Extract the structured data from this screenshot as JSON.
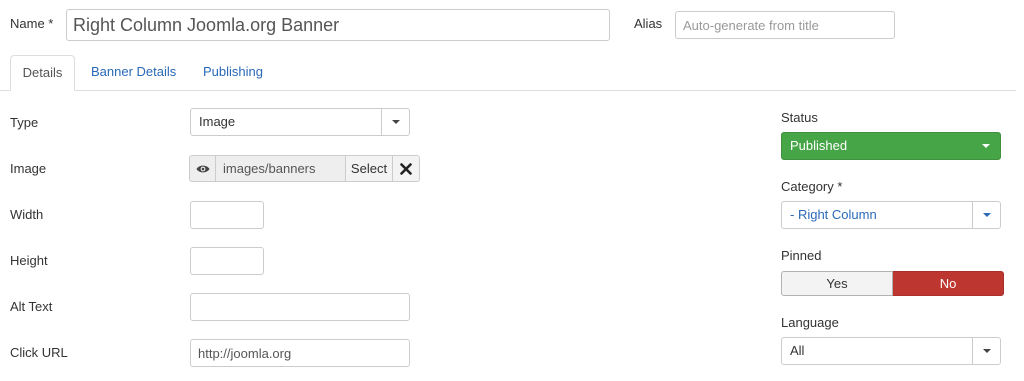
{
  "header": {
    "name_label": "Name *",
    "name_value": "Right Column Joomla.org Banner",
    "alias_label": "Alias",
    "alias_placeholder": "Auto-generate from title"
  },
  "tabs": [
    {
      "label": "Details",
      "active": true
    },
    {
      "label": "Banner Details",
      "active": false
    },
    {
      "label": "Publishing",
      "active": false
    }
  ],
  "form": {
    "type_label": "Type",
    "type_value": "Image",
    "image_label": "Image",
    "image_path": "images/banners",
    "image_select_label": "Select",
    "width_label": "Width",
    "width_value": "",
    "height_label": "Height",
    "height_value": "",
    "alt_label": "Alt Text",
    "alt_value": "",
    "url_label": "Click URL",
    "url_value": "http://joomla.org"
  },
  "sidebar": {
    "status_label": "Status",
    "status_value": "Published",
    "status_color": "#46a546",
    "category_label": "Category *",
    "category_value": "- Right Column",
    "pinned_label": "Pinned",
    "pinned_yes": "Yes",
    "pinned_no": "No",
    "pinned_selected": "No",
    "pinned_no_color": "#bd362f",
    "language_label": "Language",
    "language_value": "All"
  },
  "icons": {
    "preview": "eye-icon",
    "clear": "close-icon",
    "dropdown": "caret-down-icon"
  }
}
